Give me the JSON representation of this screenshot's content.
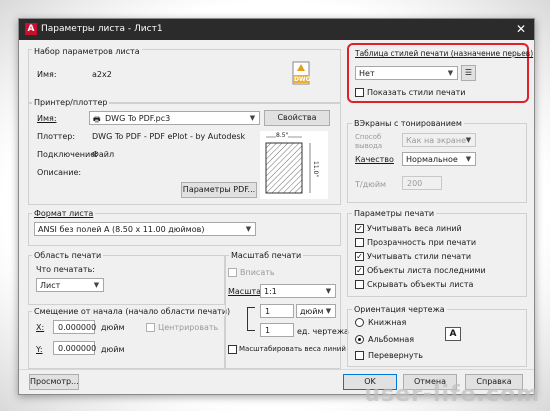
{
  "window": {
    "title": "Параметры листа - Лист1",
    "app_icon_letter": "A"
  },
  "page_setup": {
    "group_label": "Набор параметров листа",
    "name_label": "Имя:",
    "name_value": "a2x2",
    "dwg_badge": "DWG"
  },
  "printer": {
    "group_label": "Принтер/плоттер",
    "name_label": "Имя:",
    "name_value": "DWG To PDF.pc3",
    "properties_button": "Свойства",
    "plotter_label": "Плоттер:",
    "plotter_value": "DWG To PDF - PDF ePlot - by Autodesk",
    "where_label": "Подключение:",
    "where_value": "Файл",
    "desc_label": "Описание:",
    "pdf_button": "Параметры PDF...",
    "preview_width": "8.5\"",
    "preview_height": "11.0\""
  },
  "paper_size": {
    "group_label": "Формат листа",
    "value": "ANSI без полей A (8.50 x 11.00 дюймов)"
  },
  "plot_area": {
    "group_label": "Область печати",
    "what_label": "Что печатать:",
    "what_value": "Лист"
  },
  "plot_offset": {
    "group_label": "Смещение от начала (начало области печати)",
    "x_label": "X:",
    "x_value": "0.000000",
    "x_unit": "дюйм",
    "center_label": "Центрировать",
    "y_label": "Y:",
    "y_value": "0.000000",
    "y_unit": "дюйм"
  },
  "plot_scale": {
    "group_label": "Масштаб печати",
    "fit_label": "Вписать",
    "scale_label": "Масштаб:",
    "scale_value": "1:1",
    "units_value": "1",
    "units_unit": "дюйм",
    "drawing_value": "1",
    "drawing_unit": "ед. чертежа",
    "lineweights_label": "Масштабировать веса линий"
  },
  "style_table": {
    "group_label": "Таблица стилей печати (назначение перьев)",
    "value": "Нет",
    "show_label": "Показать стили печати"
  },
  "shaded": {
    "group_label": "ВЭкраны с тонированием",
    "shade_label": "Способ вывода",
    "shade_value": "Как на экране",
    "quality_label": "Качество",
    "quality_value": "Нормальное",
    "dpi_label": "Т/дюйм",
    "dpi_value": "200"
  },
  "plot_options": {
    "group_label": "Параметры печати",
    "items": [
      {
        "label": "Учитывать веса линий",
        "checked": "✓"
      },
      {
        "label": "Прозрачность при печати",
        "checked": ""
      },
      {
        "label": "Учитывать стили печати",
        "checked": "✓"
      },
      {
        "label": "Объекты листа последними",
        "checked": "✓"
      },
      {
        "label": "Скрывать объекты листа",
        "checked": ""
      }
    ]
  },
  "orientation": {
    "group_label": "Ориентация чертежа",
    "portrait_label": "Книжная",
    "landscape_label": "Альбомная",
    "upside_down_label": "Перевернуть",
    "icon_letter": "A"
  },
  "footer": {
    "preview_button": "Просмотр...",
    "ok_button": "OK",
    "cancel_button": "Отмена",
    "help_button": "Справка"
  },
  "watermark_text": "user-life.com"
}
